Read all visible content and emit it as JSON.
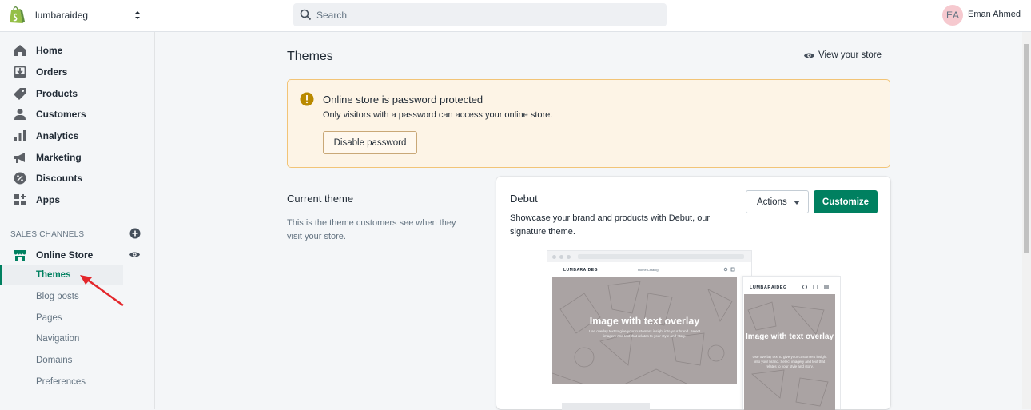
{
  "topbar": {
    "logo_icon": "shopify-bag-icon",
    "store_name": "lumbaraideg",
    "search_placeholder": "Search",
    "avatar_initials": "EA",
    "user_name": "Eman Ahmed"
  },
  "sidebar": {
    "items": [
      {
        "label": "Home",
        "icon": "home-icon"
      },
      {
        "label": "Orders",
        "icon": "orders-icon"
      },
      {
        "label": "Products",
        "icon": "tag-icon"
      },
      {
        "label": "Customers",
        "icon": "person-icon"
      },
      {
        "label": "Analytics",
        "icon": "bar-chart-icon"
      },
      {
        "label": "Marketing",
        "icon": "megaphone-icon"
      },
      {
        "label": "Discounts",
        "icon": "discount-icon"
      },
      {
        "label": "Apps",
        "icon": "apps-icon"
      }
    ],
    "channels_title": "SALES CHANNELS",
    "online_store": "Online Store",
    "sub_items": [
      "Themes",
      "Blog posts",
      "Pages",
      "Navigation",
      "Domains",
      "Preferences"
    ]
  },
  "main": {
    "title": "Themes",
    "view_store": "View your store",
    "banner": {
      "title": "Online store is password protected",
      "text": "Only visitors with a password can access your online store.",
      "button": "Disable password"
    },
    "current_theme": {
      "title": "Current theme",
      "description": "This is the theme customers see when they visit your store."
    },
    "theme_card": {
      "name": "Debut",
      "description": "Showcase your brand and products with Debut, our signature theme.",
      "actions_label": "Actions",
      "customize_label": "Customize",
      "preview": {
        "desktop_logo": "LUMBARAIDEG",
        "desktop_nav": "Home   Catalog",
        "hero_title": "Image with text overlay",
        "hero_sub": "Use overlay text to give your customers insight into your brand. Select imagery and text that relates to your style and story.",
        "mobile_logo": "LUMBARAIDEG",
        "mobile_hero_title": "Image with text overlay",
        "mobile_hero_sub": "Use overlay text to give your customers insight into your brand. Select imagery and text that relates to your style and story."
      }
    }
  },
  "colors": {
    "accent": "#008060",
    "banner_bg": "#fdf4e6",
    "banner_border": "#f2c477",
    "annotation_arrow": "#e3262b"
  }
}
